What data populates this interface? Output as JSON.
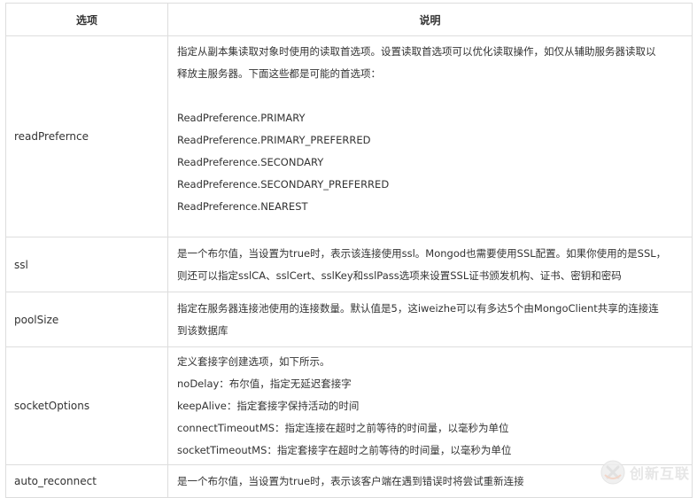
{
  "table": {
    "headers": [
      "选项",
      "说明"
    ],
    "rows": [
      {
        "name": "readPrefernce",
        "lines": [
          "指定从副本集读取对象时使用的读取首选项。设置读取首选项可以优化读取操作，如仅从辅助服务器读取以",
          "释放主服务器。下面这些都是可能的首选项：",
          "",
          "ReadPreference.PRIMARY",
          "ReadPreference.PRIMARY_PREFERRED",
          "ReadPreference.SECONDARY",
          "ReadPreference.SECONDARY_PREFERRED",
          "ReadPreference.NEAREST"
        ]
      },
      {
        "name": "ssl",
        "lines": [
          "是一个布尔值，当设置为true时，表示该连接使用ssl。Mongod也需要使用SSL配置。如果你使用的是SSL，",
          "则还可以指定sslCA、sslCert、sslKey和sslPass选项来设置SSL证书颁发机构、证书、密钥和密码"
        ]
      },
      {
        "name": "poolSize",
        "lines": [
          "指定在服务器连接池使用的连接数量。默认值是5，这iweizhe可以有多达5个由MongoClient共享的连接连",
          "到该数据库"
        ]
      },
      {
        "name": "socketOptions",
        "lines": [
          "定义套接字创建选项，如下所示。",
          "noDelay：布尔值，指定无延迟套接字",
          "keepAlive：指定套接字保持活动的时间",
          "connectTimeoutMS：指定连接在超时之前等待的时间量，以毫秒为单位",
          "socketTimeoutMS：指定套接字在超时之前等待的时间量，以毫秒为单位"
        ]
      },
      {
        "name": "auto_reconnect",
        "lines": [
          "是一个布尔值，当设置为true时，表示该客户端在遇到错误时将尝试重新连接"
        ]
      }
    ]
  },
  "watermark": {
    "text": "创新互联",
    "icon": "chuangxin-logo-icon"
  }
}
